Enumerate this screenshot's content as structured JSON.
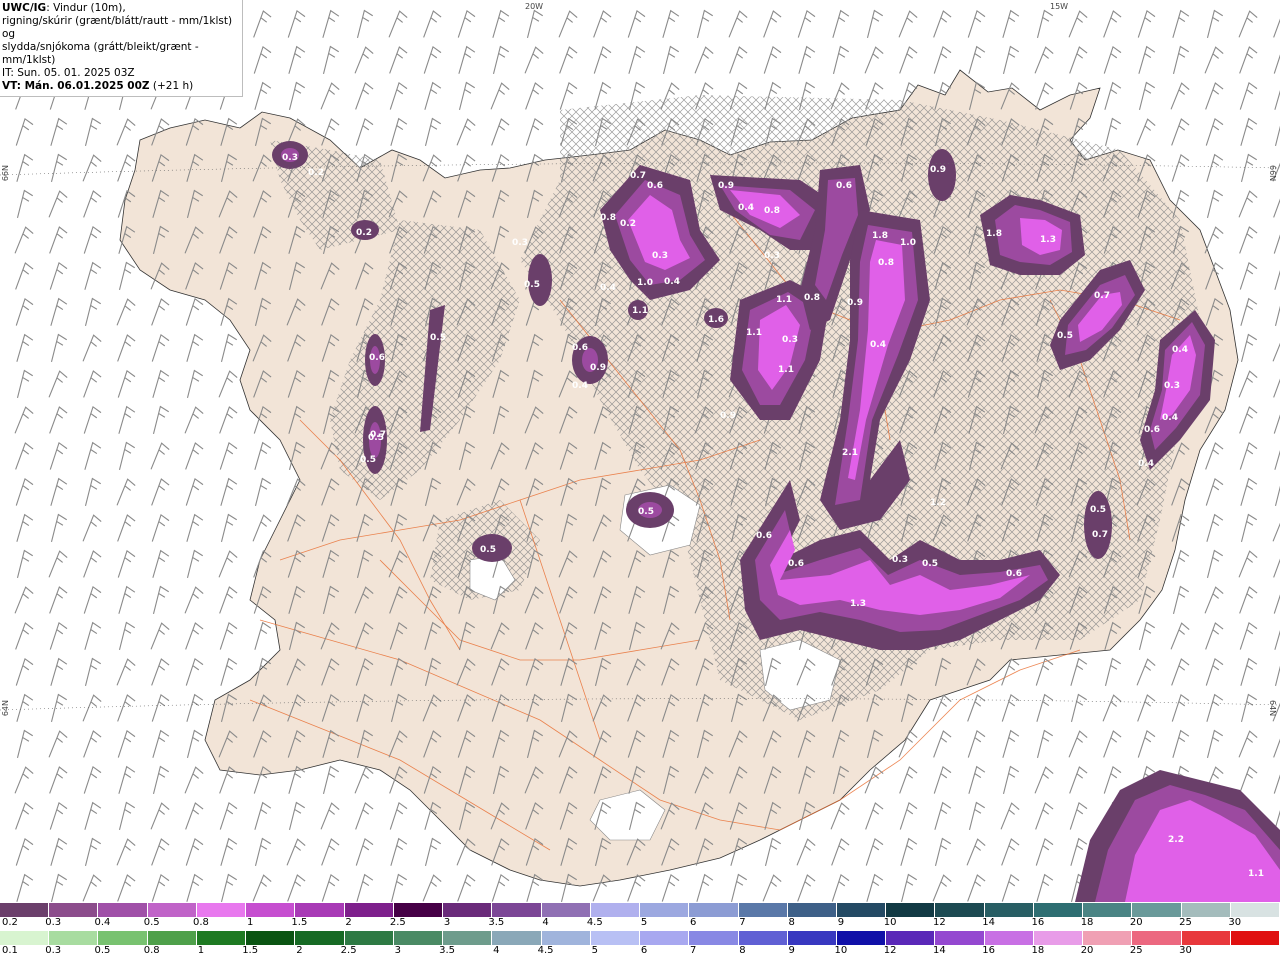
{
  "header": {
    "model": "UWC/IG",
    "line1": ": Vindur (10m),",
    "line2": "rigning/skúrir (grænt/blátt/rautt - mm/1klst) og",
    "line3": "slydda/snjókoma (grátt/bleikt/grænt - mm/1klst)",
    "it": "IT: Sun. 05. 01. 2025 03Z",
    "vt_label": "VT: Mán. 06.01.2025 00Z",
    "vt_offset": " (+21 h)"
  },
  "grid_labels": {
    "lon20": "20W",
    "lon15": "15W",
    "lat66_left": "66N",
    "lat64_left": "64N",
    "lat66_right": "66N",
    "lat64_right": "64N"
  },
  "colors": {
    "land": "#f2e4d7",
    "sea": "#ffffff",
    "roads": "#e8692b",
    "hatch": "#8a8a8a",
    "snow_dark": "#6a3f6a",
    "snow_mid": "#9c4aa0",
    "snow_light": "#e060e8"
  },
  "snow_labels": [
    "0.3",
    "0.2",
    "0.2",
    "0.3",
    "0.7",
    "0.6",
    "0.8",
    "0.2",
    "0.5",
    "0.6",
    "0.7",
    "0.5",
    "0.6",
    "0.9",
    "0.3",
    "0.4",
    "0.4",
    "1.0",
    "1.1",
    "1.6",
    "0.9",
    "0.4",
    "0.8",
    "0.6",
    "0.3",
    "1.1",
    "0.8",
    "0.9",
    "1.8",
    "1.0",
    "0.8",
    "0.4",
    "1.1",
    "0.3",
    "1.1",
    "0.9",
    "2.1",
    "1.2",
    "0.6",
    "0.6",
    "0.3",
    "0.5",
    "0.6",
    "1.3",
    "0.9",
    "1.8",
    "1.3",
    "0.7",
    "0.5",
    "0.4",
    "0.3",
    "0.4",
    "0.6",
    "0.4",
    "0.5",
    "0.7",
    "0.5",
    "0.5",
    "0.5",
    "0.5",
    "0.4",
    "2.2",
    "1.1"
  ],
  "scale_snow": {
    "labels": [
      "0.2",
      "0.3",
      "0.4",
      "0.5",
      "0.8",
      "1",
      "1.5",
      "2",
      "2.5",
      "3",
      "3.5",
      "4",
      "4.5",
      "5",
      "6",
      "7",
      "8",
      "9",
      "10",
      "12",
      "14",
      "16",
      "18",
      "20",
      "25",
      "30"
    ],
    "colors": [
      "#6b3f6b",
      "#8c4d8c",
      "#a050a8",
      "#c063c8",
      "#e878ee",
      "#c64ed0",
      "#a83ab6",
      "#7e1f8c",
      "#460046",
      "#6a2a7a",
      "#7c4696",
      "#9070b4",
      "#b0b0ee",
      "#9ca8e0",
      "#8c9cd4",
      "#5a78a8",
      "#3e6088",
      "#244a64",
      "#123a44",
      "#1c4a52",
      "#285e64",
      "#2e6e72",
      "#4a8484",
      "#6a9a9a",
      "#a4bcbc",
      "#d8e2e2"
    ]
  },
  "scale_rain": {
    "labels": [
      "0.1",
      "0.3",
      "0.5",
      "0.8",
      "1",
      "1.5",
      "2",
      "2.5",
      "3",
      "3.5",
      "4",
      "4.5",
      "5",
      "6",
      "7",
      "8",
      "9",
      "10",
      "12",
      "14",
      "16",
      "18",
      "20",
      "25",
      "30"
    ],
    "colors": [
      "#d8f4d0",
      "#a8dca0",
      "#78c270",
      "#4ea04a",
      "#1e7a22",
      "#0a5412",
      "#166a24",
      "#2e7a44",
      "#4a8a64",
      "#6e9c8c",
      "#8aa8b8",
      "#a0b4dc",
      "#b8c0f4",
      "#a8a8f0",
      "#8888e4",
      "#6060d4",
      "#3838c0",
      "#1010a8",
      "#5a28b8",
      "#9448d0",
      "#c870e4",
      "#e89ce8",
      "#f0a0b4",
      "#ec6880",
      "#e8383c",
      "#e01010"
    ]
  }
}
